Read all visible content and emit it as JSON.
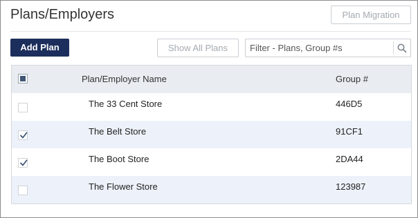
{
  "header": {
    "title": "Plans/Employers",
    "plan_migration_label": "Plan Migration"
  },
  "toolbar": {
    "add_plan_label": "Add Plan",
    "show_all_plans_label": "Show All Plans",
    "filter_placeholder": "Filter - Plans, Group #s",
    "filter_icon": "search-icon"
  },
  "table": {
    "columns": {
      "name": "Plan/Employer Name",
      "group": "Group #"
    },
    "select_all_state": "indeterminate",
    "rows": [
      {
        "name": "The 33 Cent Store",
        "group": "446D5",
        "checked": false
      },
      {
        "name": "The Belt Store",
        "group": "91CF1",
        "checked": true
      },
      {
        "name": "The Boot Store",
        "group": "2DA44",
        "checked": true
      },
      {
        "name": "The Flower Store",
        "group": "123987",
        "checked": false
      }
    ]
  },
  "colors": {
    "primary_button": "#1c2e5b",
    "header_row": "#e9ecf1",
    "striped_row": "#edf2fa",
    "checkbox_mark": "#3f5676"
  }
}
